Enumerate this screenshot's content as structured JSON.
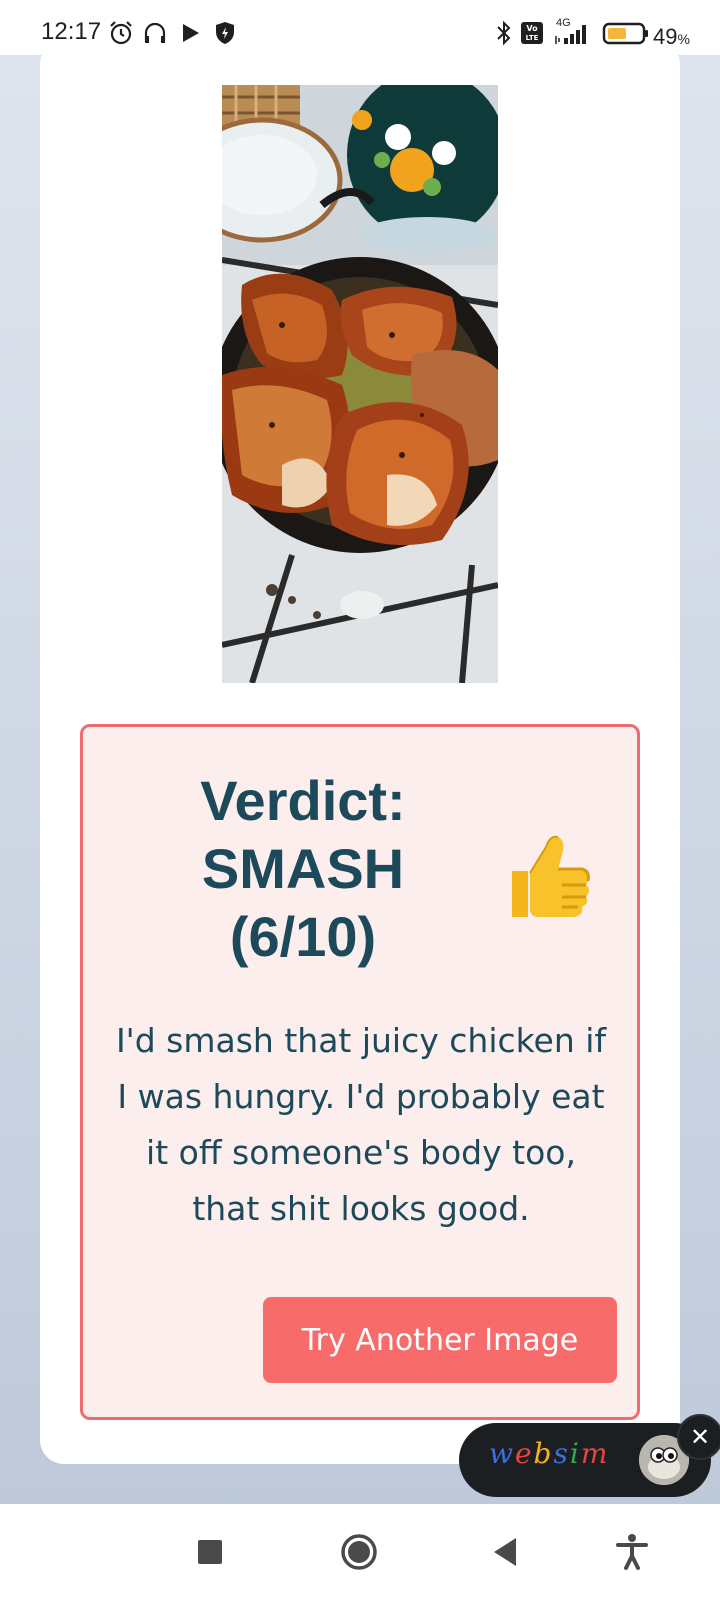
{
  "status_bar": {
    "time": "12:17",
    "battery_percent": "49",
    "battery_unit": "%",
    "network": "4G",
    "volte": "Vo LTE",
    "icons": [
      "alarm-icon",
      "headphones-icon",
      "play-icon",
      "shield-icon",
      "bluetooth-icon",
      "volte-icon",
      "signal-icon",
      "battery-icon"
    ]
  },
  "verdict": {
    "title_line1": "Verdict:",
    "title_line2": "SMASH",
    "title_line3": "(6/10)",
    "emoji_icon": "thumbs-up-icon",
    "text": "I'd smash that juicy chicken if I was hungry. I'd probably eat it off someone's body too, that shit looks good."
  },
  "button": {
    "label": "Try Another Image"
  },
  "badge": {
    "logo_text": "websim",
    "close_icon": "close-icon"
  },
  "nav_bar": {
    "icons": [
      "recent-apps-icon",
      "home-icon",
      "back-icon",
      "accessibility-icon"
    ]
  },
  "colors": {
    "panel_border": "#ee6b6f",
    "panel_bg": "#fdeeee",
    "heading_text": "#1c4a5a",
    "button_bg": "#f76b6b",
    "battery_fill": "#f5b63a",
    "badge_bg": "#1c1f22"
  }
}
